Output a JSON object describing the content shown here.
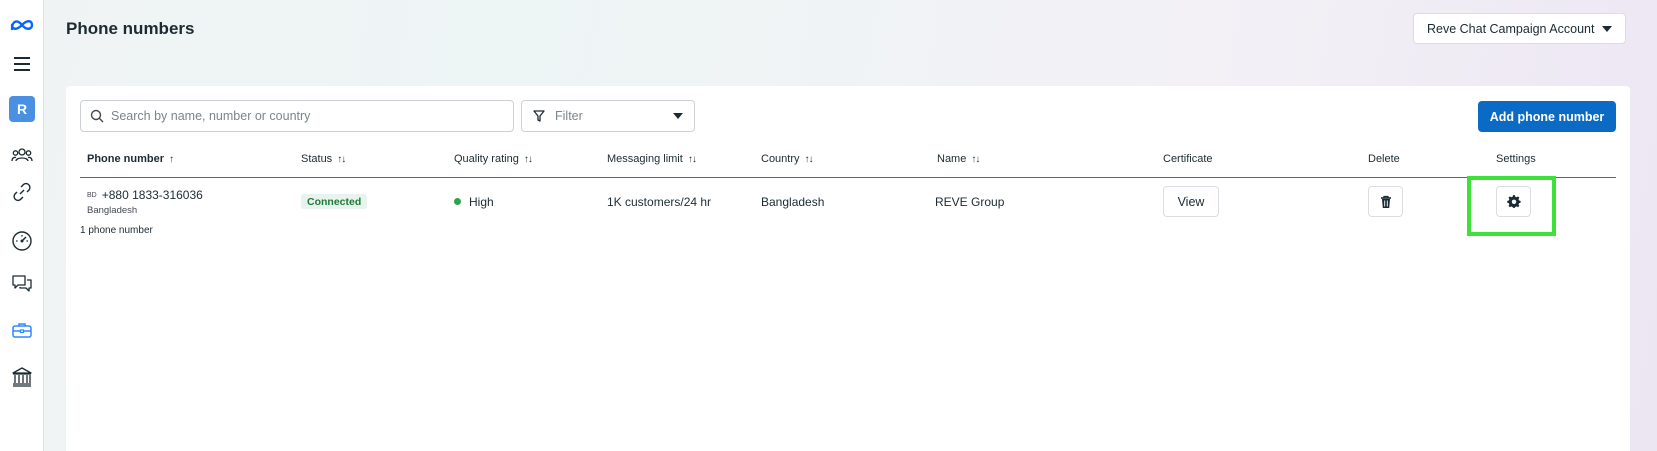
{
  "sidebar": {
    "logo": "meta-logo-icon",
    "avatar_letter": "R",
    "items": [
      "menu-icon",
      "people-icon",
      "link-icon",
      "dashboard-icon",
      "chat-icon",
      "briefcase-icon",
      "bank-icon"
    ],
    "active_color": "#4a90e2"
  },
  "header": {
    "title": "Phone numbers",
    "account": "Reve Chat Campaign Account"
  },
  "toolbar": {
    "search_placeholder": "Search by name, number or country",
    "filter_label": "Filter",
    "add_label": "Add phone number"
  },
  "table": {
    "columns": {
      "phone": "Phone number",
      "status": "Status",
      "quality": "Quality rating",
      "limit": "Messaging limit",
      "country": "Country",
      "name": "Name",
      "certificate": "Certificate",
      "delete": "Delete",
      "settings": "Settings"
    },
    "sort_glyph": "↑↓",
    "phone_sort_glyph": "↑",
    "rows": [
      {
        "country_code": "BD",
        "phone": "+880 1833-316036",
        "phone_country": "Bangladesh",
        "status": "Connected",
        "quality": "High",
        "limit": "1K customers/24 hr",
        "country": "Bangladesh",
        "name": "REVE Group",
        "certificate_button": "View"
      }
    ],
    "footer_count": "1 phone number"
  },
  "colors": {
    "primary_button": "#0b6bc4",
    "connected_badge_bg": "#e7f3ec",
    "connected_badge_text": "#1f7a3c",
    "quality_dot": "#31a24c",
    "highlight_box": "#3ee03a"
  }
}
